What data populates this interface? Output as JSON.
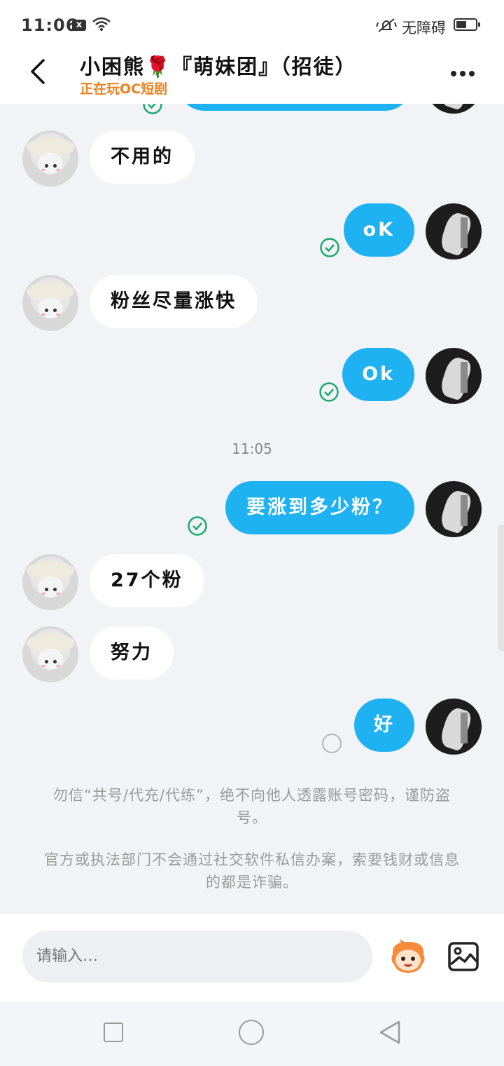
{
  "status_bar": {
    "time": "11:06",
    "notification_badge": "x",
    "accessibility_label": "无障碍",
    "icons": [
      "notification-x-icon",
      "wifi-icon",
      "vibrate-icon",
      "battery-icon"
    ]
  },
  "header": {
    "title": "小困熊🌹『萌妹团』（招徒）",
    "subtitle": "正在玩OC短剧",
    "icons": [
      "back-arrow-icon",
      "more-icon"
    ]
  },
  "messages": [
    {
      "side": "in",
      "text": "不用的"
    },
    {
      "side": "out",
      "text": "oK",
      "status": "read"
    },
    {
      "side": "in",
      "text": "粉丝尽量涨快"
    },
    {
      "side": "out",
      "text": "Ok",
      "status": "read"
    },
    {
      "side": "out",
      "text": "要涨到多少粉？",
      "status": "read"
    },
    {
      "side": "in",
      "text": "27个粉"
    },
    {
      "side": "in",
      "text": "努力"
    },
    {
      "side": "out",
      "text": "好",
      "status": "pending"
    }
  ],
  "time_divider": "11:05",
  "notices": [
    "勿信“共号/代充/代练”，绝不向他人透露账号密码，谨防盗号。",
    "官方或执法部门不会通过社交软件私信办案，索要钱财或信息的都是诈骗。"
  ],
  "input": {
    "placeholder": "请输入…"
  },
  "colors": {
    "outgoing_bubble": "#1fb2f3",
    "incoming_bubble": "#ffffff",
    "read_check": "#1aaa6e",
    "subtitle": "#f0801f",
    "background": "#f2f3f7"
  }
}
